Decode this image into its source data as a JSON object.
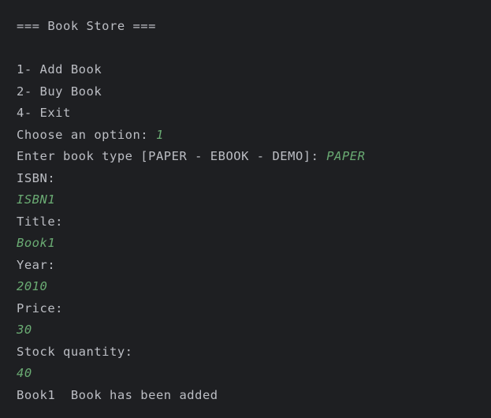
{
  "console": {
    "header": "=== Book Store ===",
    "menu": [
      "1- Add Book",
      "2- Buy Book",
      "4- Exit"
    ],
    "choose_prompt": "Choose an option: ",
    "choose_input": "1",
    "type_prompt": "Enter book type [PAPER - EBOOK - DEMO]: ",
    "type_input": "PAPER",
    "isbn_prompt": "ISBN:",
    "isbn_input": "ISBN1",
    "title_prompt": "Title:",
    "title_input": "Book1",
    "year_prompt": "Year:",
    "year_input": "2010",
    "price_prompt": "Price:",
    "price_input": "30",
    "stock_prompt": "Stock quantity:",
    "stock_input": "40",
    "result": "Book1  Book has been added"
  },
  "colors": {
    "background": "#1e1f22",
    "text": "#bcbec4",
    "user_input": "#6aab73"
  }
}
